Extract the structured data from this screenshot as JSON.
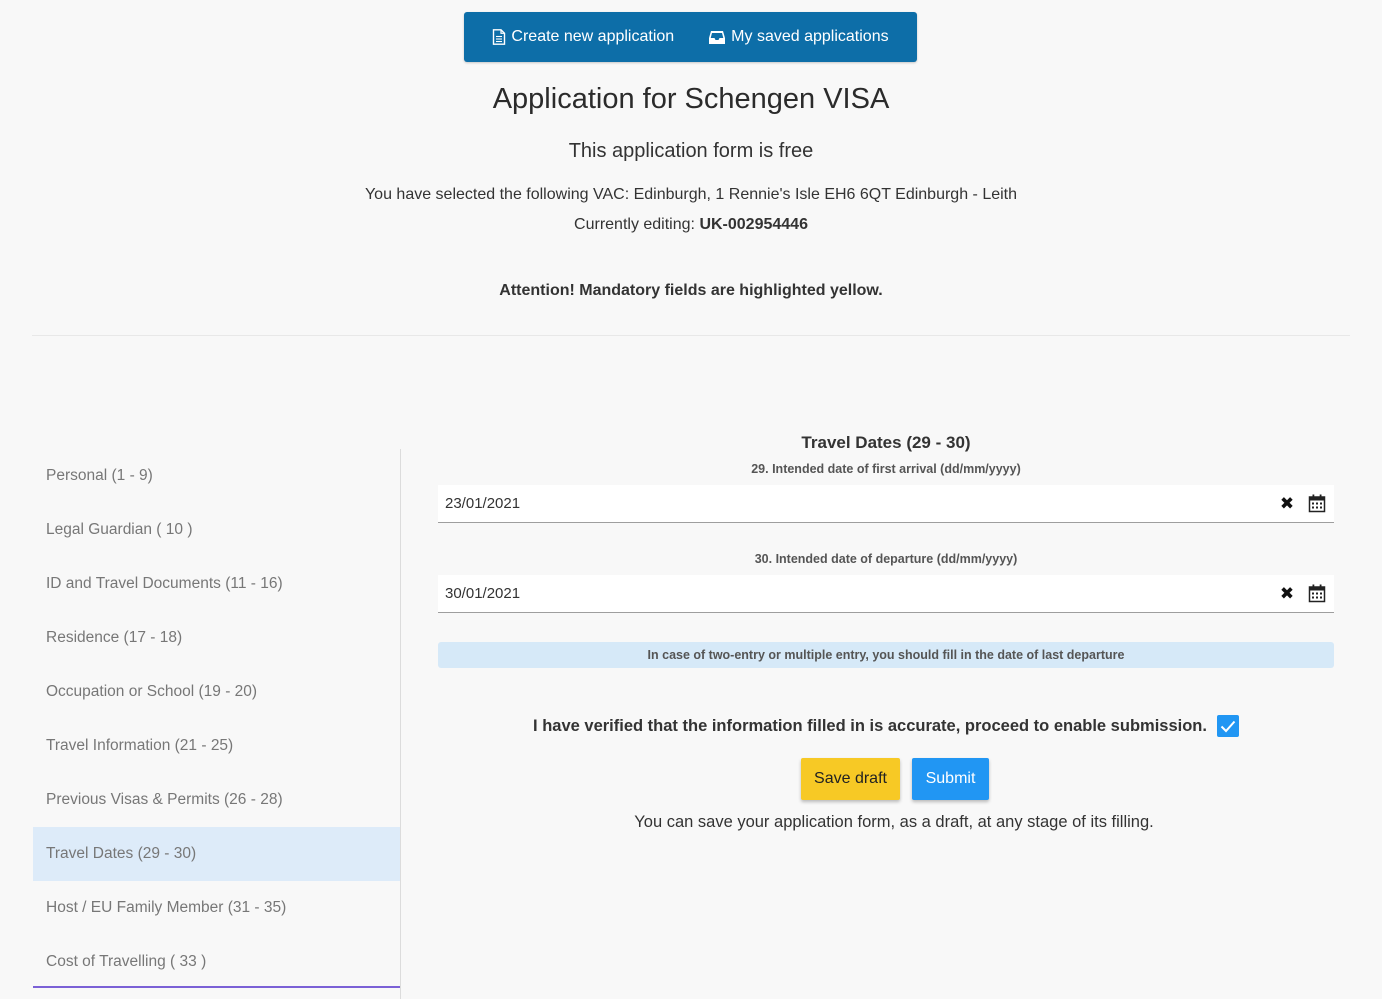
{
  "topbar": {
    "create_label": "Create new application",
    "saved_label": "My saved applications",
    "color": "#0d6ea8"
  },
  "header": {
    "title": "Application for Schengen VISA",
    "subtitle": "This application form is free",
    "vac_text": "You have selected the following VAC: Edinburgh, 1 Rennie's Isle EH6 6QT Edinburgh - Leith",
    "editing_label": "Currently editing:",
    "editing_id": "UK-002954446",
    "attention": "Attention! Mandatory fields are highlighted yellow."
  },
  "sidebar": {
    "items": [
      {
        "label": "Personal (1 - 9)"
      },
      {
        "label": "Legal Guardian ( 10 )"
      },
      {
        "label": "ID and Travel Documents (11 - 16)"
      },
      {
        "label": "Residence (17 - 18)"
      },
      {
        "label": "Occupation or School (19 - 20)"
      },
      {
        "label": "Travel Information (21 - 25)"
      },
      {
        "label": "Previous Visas & Permits (26 - 28)"
      },
      {
        "label": "Travel Dates (29 - 30)"
      },
      {
        "label": "Host / EU Family Member (31 - 35)"
      },
      {
        "label": "Cost of Travelling ( 33 )"
      }
    ],
    "active_index": 7,
    "active_color": "#ddebf9"
  },
  "form": {
    "section_title": "Travel Dates (29 - 30)",
    "arrival_label": "29. Intended date of first arrival (dd/mm/yyyy)",
    "arrival_value": "23/01/2021",
    "departure_label": "30. Intended date of departure (dd/mm/yyyy)",
    "departure_value": "30/01/2021",
    "info_note": "In case of two-entry or multiple entry, you should fill in the date of last departure",
    "verify_text": "I have verified that the information filled in is accurate, proceed to enable submission.",
    "verify_checked": true,
    "save_draft_label": "Save draft",
    "submit_label": "Submit",
    "save_note": "You can save your application form, as a draft, at any stage of its filling.",
    "draft_color": "#f7c925",
    "submit_color": "#2196f3"
  }
}
